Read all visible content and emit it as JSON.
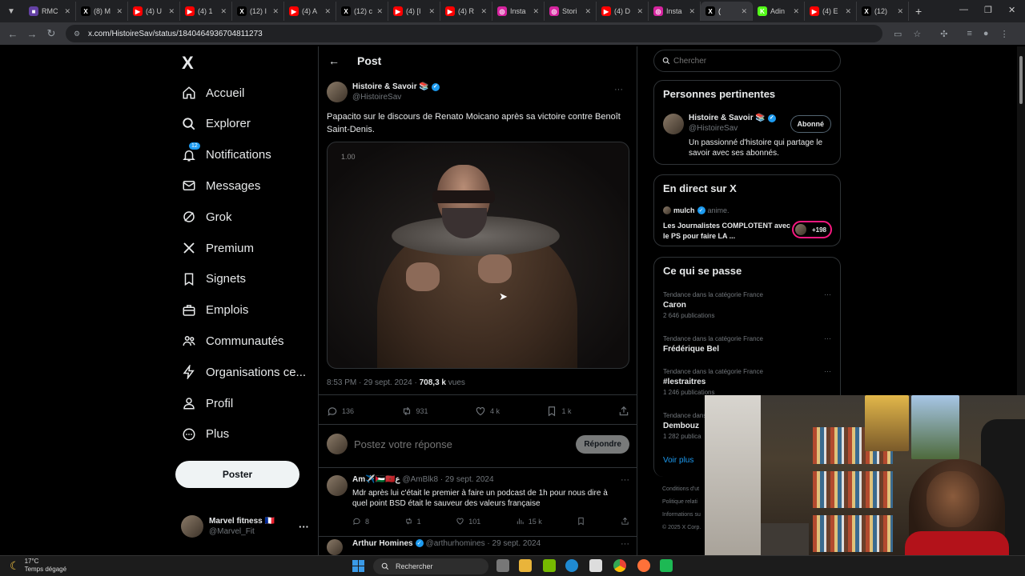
{
  "browser": {
    "tabs": [
      {
        "label": "RMC",
        "color": "#6441a5",
        "glyph": "■"
      },
      {
        "label": "(8) M",
        "color": "#000000",
        "glyph": "X"
      },
      {
        "label": "(4) U",
        "color": "#ff0000",
        "glyph": "▶"
      },
      {
        "label": "(4) 1",
        "color": "#ff0000",
        "glyph": "▶"
      },
      {
        "label": "(12) I",
        "color": "#000000",
        "glyph": "X"
      },
      {
        "label": "(4) A",
        "color": "#ff0000",
        "glyph": "▶"
      },
      {
        "label": "(12) c",
        "color": "#000000",
        "glyph": "X"
      },
      {
        "label": "(4) [I",
        "color": "#ff0000",
        "glyph": "▶"
      },
      {
        "label": "(4) R",
        "color": "#ff0000",
        "glyph": "▶"
      },
      {
        "label": "Insta",
        "color": "#d6249f",
        "glyph": "◎"
      },
      {
        "label": "Stori",
        "color": "#d6249f",
        "glyph": "◎"
      },
      {
        "label": "(4) D",
        "color": "#ff0000",
        "glyph": "▶"
      },
      {
        "label": "Insta",
        "color": "#d6249f",
        "glyph": "◎"
      },
      {
        "label": "(",
        "color": "#000000",
        "glyph": "X"
      },
      {
        "label": "Adin",
        "color": "#53fc18",
        "glyph": "K"
      },
      {
        "label": "(4) E",
        "color": "#ff0000",
        "glyph": "▶"
      },
      {
        "label": "(12)",
        "color": "#000000",
        "glyph": "X"
      }
    ],
    "active_tab_index": 13,
    "url": "x.com/HistoireSav/status/1840464936704811273"
  },
  "nav": {
    "logo": "X",
    "items": [
      {
        "label": "Accueil",
        "icon": "home-icon"
      },
      {
        "label": "Explorer",
        "icon": "search-icon"
      },
      {
        "label": "Notifications",
        "icon": "bell-icon",
        "badge": "12"
      },
      {
        "label": "Messages",
        "icon": "mail-icon"
      },
      {
        "label": "Grok",
        "icon": "grok-icon"
      },
      {
        "label": "Premium",
        "icon": "x-icon"
      },
      {
        "label": "Signets",
        "icon": "bookmark-icon"
      },
      {
        "label": "Emplois",
        "icon": "briefcase-icon"
      },
      {
        "label": "Communautés",
        "icon": "people-icon"
      },
      {
        "label": "Organisations ce...",
        "icon": "bolt-icon"
      },
      {
        "label": "Profil",
        "icon": "person-icon"
      },
      {
        "label": "Plus",
        "icon": "more-circle-icon"
      }
    ],
    "post_button": "Poster",
    "account": {
      "name": "Marvel fitness 🇫🇷",
      "handle": "@Marvel_Fit"
    }
  },
  "main": {
    "header_title": "Post",
    "tweet": {
      "author_name": "Histoire & Savoir 📚",
      "author_handle": "@HistoireSav",
      "text": "Papacito sur le discours de Renato Moicano après sa victoire contre Benoît Saint-Denis.",
      "media_label": "1.00",
      "time": "8:53 PM · 29 sept. 2024 · ",
      "views_count": "708,3 k",
      "views_label": " vues",
      "replies": "136",
      "reposts": "931",
      "likes": "4 k",
      "bookmarks": "1 k"
    },
    "reply_box": {
      "placeholder": "Postez votre réponse",
      "button": "Répondre"
    },
    "replies": [
      {
        "name": "Am✈️🇵🇸🇲🇦ع",
        "handle": "@AmBlk8 · 29 sept. 2024",
        "text": "Mdr après lui c'était le premier à faire un podcast de 1h pour nous dire à quel point BSD était le sauveur des valeurs française",
        "replies": "8",
        "reposts": "1",
        "likes": "101",
        "views": "15 k"
      },
      {
        "name": "Arthur Homines",
        "handle": "@arthurhomines · 29 sept. 2024",
        "text": ""
      }
    ]
  },
  "right": {
    "search_placeholder": "Chercher",
    "relevant": {
      "title": "Personnes pertinentes",
      "name": "Histoire & Savoir 📚",
      "handle": "@HistoireSav",
      "button": "Abonné",
      "bio": "Un passionné d'histoire qui partage le savoir avec ses abonnés."
    },
    "live": {
      "title": "En direct sur X",
      "host": "mulch",
      "host_tag": "anime.",
      "text": "Les Journalistes COMPLOTENT avec le PS pour faire LA ...",
      "count": "+198"
    },
    "trends": {
      "title": "Ce qui se passe",
      "items": [
        {
          "category": "Tendance dans la catégorie France",
          "name": "Caron",
          "count": "2 646 publications"
        },
        {
          "category": "Tendance dans la catégorie France",
          "name": "Frédérique Bel",
          "count": ""
        },
        {
          "category": "Tendance dans la catégorie France",
          "name": "#lestraitres",
          "count": "1 246 publications"
        },
        {
          "category": "Tendance dans la",
          "name": "Dembouz",
          "count": "1 282 publica"
        }
      ],
      "more": "Voir plus"
    },
    "footer": [
      "Conditions d'ut",
      "Politique relati",
      "Informations su",
      "© 2025 X Corp."
    ]
  },
  "taskbar": {
    "temp": "17°C",
    "weather": "Temps dégagé",
    "search": "Rechercher"
  }
}
